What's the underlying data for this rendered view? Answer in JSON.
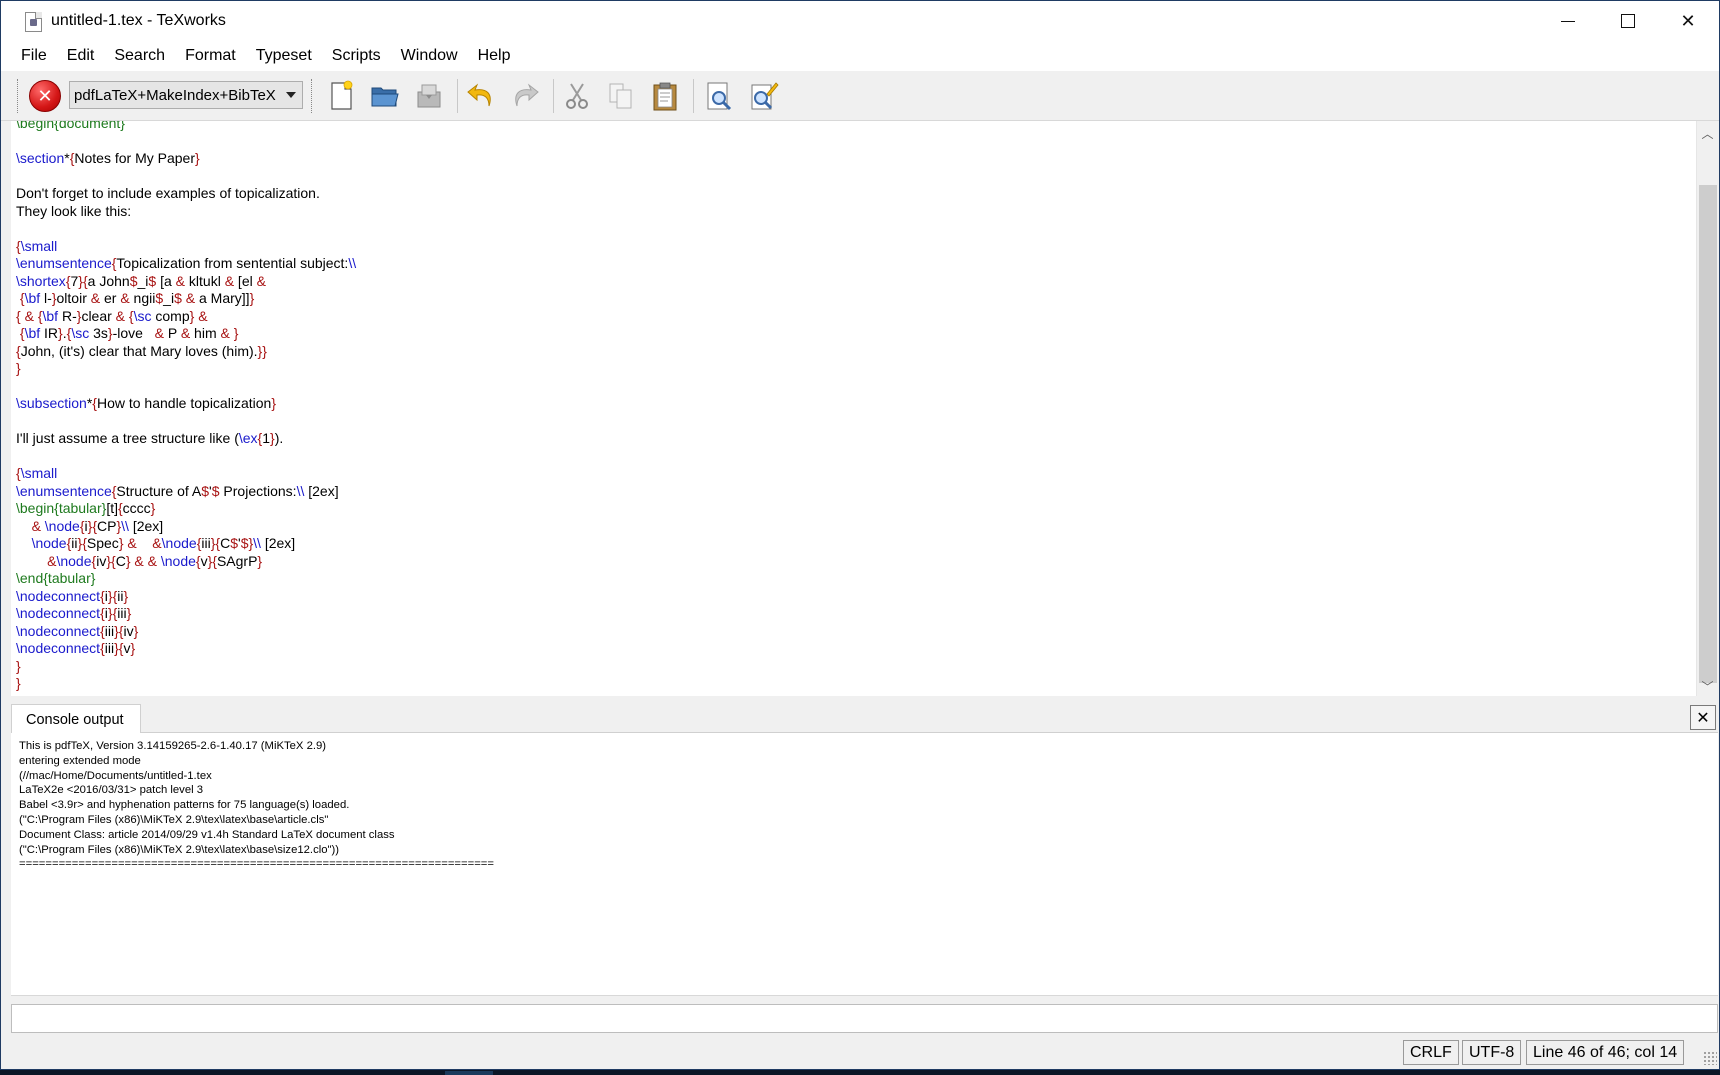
{
  "window": {
    "title": "untitled-1.tex - TeXworks"
  },
  "menu": [
    "File",
    "Edit",
    "Search",
    "Format",
    "Typeset",
    "Scripts",
    "Window",
    "Help"
  ],
  "toolbar": {
    "typeset_engine": "pdfLaTeX+MakeIndex+BibTeX",
    "buttons": [
      "stop-typeset",
      "new-document",
      "open-document",
      "save-document",
      "undo",
      "redo",
      "cut",
      "copy",
      "paste",
      "find",
      "replace"
    ]
  },
  "editor": {
    "lines": [
      [
        [
          "env",
          "\\begin{document}"
        ]
      ],
      [],
      [
        [
          "kw",
          "\\section"
        ],
        [
          "",
          "*"
        ],
        [
          "br",
          "{"
        ],
        [
          "",
          "Notes for My Paper"
        ],
        [
          "br",
          "}"
        ]
      ],
      [],
      [
        [
          "",
          "Don't forget to include examples of topicalization."
        ]
      ],
      [
        [
          "",
          "They look like this:"
        ]
      ],
      [],
      [
        [
          "br",
          "{"
        ],
        [
          "kw",
          "\\small"
        ]
      ],
      [
        [
          "kw",
          "\\enumsentence"
        ],
        [
          "br",
          "{"
        ],
        [
          "",
          "Topicalization from sentential subject:"
        ],
        [
          "kw",
          "\\\\"
        ]
      ],
      [
        [
          "kw",
          "\\shortex"
        ],
        [
          "br",
          "{"
        ],
        [
          "",
          "7"
        ],
        [
          "br",
          "}{"
        ],
        [
          "",
          "a John"
        ],
        [
          "br",
          "$"
        ],
        [
          "",
          "_i"
        ],
        [
          "br",
          "$"
        ],
        [
          "",
          "",
          " [a "
        ],
        [
          "br",
          "&"
        ],
        [
          "",
          " kltukl "
        ],
        [
          "br",
          "&"
        ],
        [
          "",
          " [el "
        ],
        [
          "br",
          "&"
        ]
      ],
      [
        [
          "",
          "",
          " "
        ],
        [
          "br",
          "{"
        ],
        [
          "kw",
          "\\bf"
        ],
        [
          "",
          " l-"
        ],
        [
          "br",
          "}"
        ],
        [
          "",
          "oltoir "
        ],
        [
          "br",
          "&"
        ],
        [
          "",
          " er "
        ],
        [
          "br",
          "&"
        ],
        [
          "",
          " ngii"
        ],
        [
          "br",
          "$"
        ],
        [
          "",
          "_i"
        ],
        [
          "br",
          "$"
        ],
        [
          "",
          "",
          " "
        ],
        [
          "br",
          "&"
        ],
        [
          "",
          " a Mary]]"
        ],
        [
          "br",
          "}"
        ]
      ],
      [
        [
          "br",
          "{"
        ],
        [
          "",
          " "
        ],
        [
          "br",
          "&"
        ],
        [
          "",
          " "
        ],
        [
          "br",
          "{"
        ],
        [
          "kw",
          "\\bf"
        ],
        [
          "",
          " R-"
        ],
        [
          "br",
          "}"
        ],
        [
          "",
          "clear "
        ],
        [
          "br",
          "&"
        ],
        [
          "",
          " "
        ],
        [
          "br",
          "{"
        ],
        [
          "kw",
          "\\sc"
        ],
        [
          "",
          " comp"
        ],
        [
          "br",
          "}"
        ],
        [
          "",
          " "
        ],
        [
          "br",
          "&"
        ]
      ],
      [
        [
          "",
          "",
          " "
        ],
        [
          "br",
          "{"
        ],
        [
          "kw",
          "\\bf"
        ],
        [
          "",
          " IR"
        ],
        [
          "br",
          "}"
        ],
        [
          "",
          "."
        ],
        [
          "br",
          "{"
        ],
        [
          "kw",
          "\\sc"
        ],
        [
          "",
          " 3s"
        ],
        [
          "br",
          "}"
        ],
        [
          "",
          "-love   "
        ],
        [
          "br",
          "&"
        ],
        [
          "",
          " P "
        ],
        [
          "br",
          "&"
        ],
        [
          "",
          " him "
        ],
        [
          "br",
          "&"
        ],
        [
          "",
          " "
        ],
        [
          "br",
          "}"
        ]
      ],
      [
        [
          "br",
          "{"
        ],
        [
          "",
          "John, (it's) clear that Mary loves (him)."
        ],
        [
          "br",
          "}}"
        ]
      ],
      [
        [
          "br",
          "}"
        ]
      ],
      [],
      [
        [
          "kw",
          "\\subsection"
        ],
        [
          "",
          "*"
        ],
        [
          "br",
          "{"
        ],
        [
          "",
          "How to handle topicalization"
        ],
        [
          "br",
          "}"
        ]
      ],
      [],
      [
        [
          "",
          "I'll just assume a tree structure like ("
        ],
        [
          "kw",
          "\\ex"
        ],
        [
          "br",
          "{"
        ],
        [
          "",
          "1"
        ],
        [
          "br",
          "}"
        ],
        [
          "",
          ")."
        ]
      ],
      [],
      [
        [
          "br",
          "{"
        ],
        [
          "kw",
          "\\small"
        ]
      ],
      [
        [
          "kw",
          "\\enumsentence"
        ],
        [
          "br",
          "{"
        ],
        [
          "",
          "Structure of A"
        ],
        [
          "br",
          "$"
        ],
        [
          "",
          "'"
        ],
        [
          "br",
          "$"
        ],
        [
          "",
          " Projections:"
        ],
        [
          "kw",
          "\\\\"
        ],
        [
          "",
          " [2ex]"
        ]
      ],
      [
        [
          "env",
          "\\begin{tabular}"
        ],
        [
          "",
          "[t]"
        ],
        [
          "br",
          "{"
        ],
        [
          "",
          "cccc"
        ],
        [
          "br",
          "}"
        ]
      ],
      [
        [
          "",
          "    "
        ],
        [
          "br",
          "&"
        ],
        [
          "",
          " "
        ],
        [
          "kw",
          "\\node"
        ],
        [
          "br",
          "{"
        ],
        [
          "",
          "i"
        ],
        [
          "br",
          "}{"
        ],
        [
          "",
          "CP"
        ],
        [
          "br",
          "}"
        ],
        [
          "kw",
          "\\\\"
        ],
        [
          "",
          " [2ex]"
        ]
      ],
      [
        [
          "",
          "    "
        ],
        [
          "kw",
          "\\node"
        ],
        [
          "br",
          "{"
        ],
        [
          "",
          "ii"
        ],
        [
          "br",
          "}{"
        ],
        [
          "",
          "Spec"
        ],
        [
          "br",
          "}"
        ],
        [
          "",
          " "
        ],
        [
          "br",
          "&"
        ],
        [
          "",
          "    "
        ],
        [
          "br",
          "&"
        ],
        [
          "kw",
          "\\node"
        ],
        [
          "br",
          "{"
        ],
        [
          "",
          "iii"
        ],
        [
          "br",
          "}{"
        ],
        [
          "",
          "C"
        ],
        [
          "br",
          "$"
        ],
        [
          "",
          "'"
        ],
        [
          "br",
          "$"
        ],
        [
          "br",
          "}"
        ],
        [
          "kw",
          "\\\\"
        ],
        [
          "",
          " [2ex]"
        ]
      ],
      [
        [
          "",
          "        "
        ],
        [
          "br",
          "&"
        ],
        [
          "kw",
          "\\node"
        ],
        [
          "br",
          "{"
        ],
        [
          "",
          "iv"
        ],
        [
          "br",
          "}{"
        ],
        [
          "",
          "C"
        ],
        [
          "br",
          "}"
        ],
        [
          "",
          " "
        ],
        [
          "br",
          "&"
        ],
        [
          "",
          " "
        ],
        [
          "br",
          "&"
        ],
        [
          "",
          " "
        ],
        [
          "kw",
          "\\node"
        ],
        [
          "br",
          "{"
        ],
        [
          "",
          "v"
        ],
        [
          "br",
          "}{"
        ],
        [
          "",
          "SAgrP"
        ],
        [
          "br",
          "}"
        ]
      ],
      [
        [
          "env",
          "\\end{tabular}"
        ]
      ],
      [
        [
          "kw",
          "\\nodeconnect"
        ],
        [
          "br",
          "{"
        ],
        [
          "",
          "i"
        ],
        [
          "br",
          "}{"
        ],
        [
          "",
          "ii"
        ],
        [
          "br",
          "}"
        ]
      ],
      [
        [
          "kw",
          "\\nodeconnect"
        ],
        [
          "br",
          "{"
        ],
        [
          "",
          "i"
        ],
        [
          "br",
          "}{"
        ],
        [
          "",
          "iii"
        ],
        [
          "br",
          "}"
        ]
      ],
      [
        [
          "kw",
          "\\nodeconnect"
        ],
        [
          "br",
          "{"
        ],
        [
          "",
          "iii"
        ],
        [
          "br",
          "}{"
        ],
        [
          "",
          "iv"
        ],
        [
          "br",
          "}"
        ]
      ],
      [
        [
          "kw",
          "\\nodeconnect"
        ],
        [
          "br",
          "{"
        ],
        [
          "",
          "iii"
        ],
        [
          "br",
          "}{"
        ],
        [
          "",
          "v"
        ],
        [
          "br",
          "}"
        ]
      ],
      [
        [
          "br",
          "}"
        ]
      ],
      [
        [
          "br",
          "}"
        ]
      ]
    ]
  },
  "console": {
    "tab_label": "Console output",
    "lines": [
      "This is pdfTeX, Version 3.14159265-2.6-1.40.17 (MiKTeX 2.9)",
      "entering extended mode",
      "(//mac/Home/Documents/untitled-1.tex",
      "LaTeX2e <2016/03/31> patch level 3",
      "Babel <3.9r> and hyphenation patterns for 75 language(s) loaded.",
      "(\"C:\\Program Files (x86)\\MiKTeX 2.9\\tex\\latex\\base\\article.cls\"",
      "Document Class: article 2014/09/29 v1.4h Standard LaTeX document class",
      "(\"C:\\Program Files (x86)\\MiKTeX 2.9\\tex\\latex\\base\\size12.clo\"))",
      "========================================================================"
    ],
    "input_value": ""
  },
  "status": {
    "line_ending": "CRLF",
    "encoding": "UTF-8",
    "cursor_position": "Line 46 of 46; col 14"
  }
}
